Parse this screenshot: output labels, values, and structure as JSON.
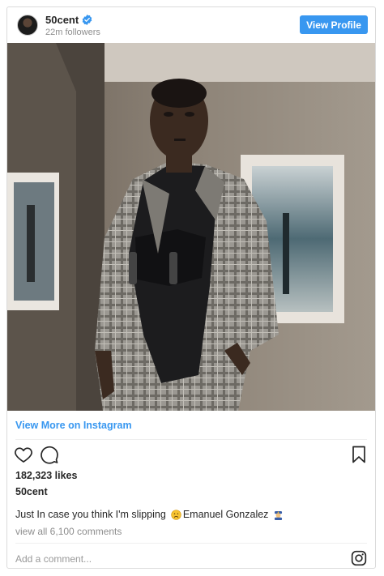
{
  "header": {
    "username": "50cent",
    "followers": "22m followers",
    "view_profile_label": "View Profile"
  },
  "post": {
    "view_more_label": "View More on Instagram",
    "likes": "182,323 likes",
    "owner": "50cent",
    "caption_text": "Just In case you think I'm slipping",
    "caption_mention": "Emanuel Gonzalez",
    "comments_link": "view all 6,100 comments",
    "comment_placeholder": "Add a comment..."
  },
  "colors": {
    "accent": "#3897f0",
    "muted": "#8e8e8e",
    "text": "#262626"
  },
  "icons": [
    "verified-badge-icon",
    "heart-icon",
    "comment-icon",
    "bookmark-icon",
    "instagram-logo-icon"
  ]
}
